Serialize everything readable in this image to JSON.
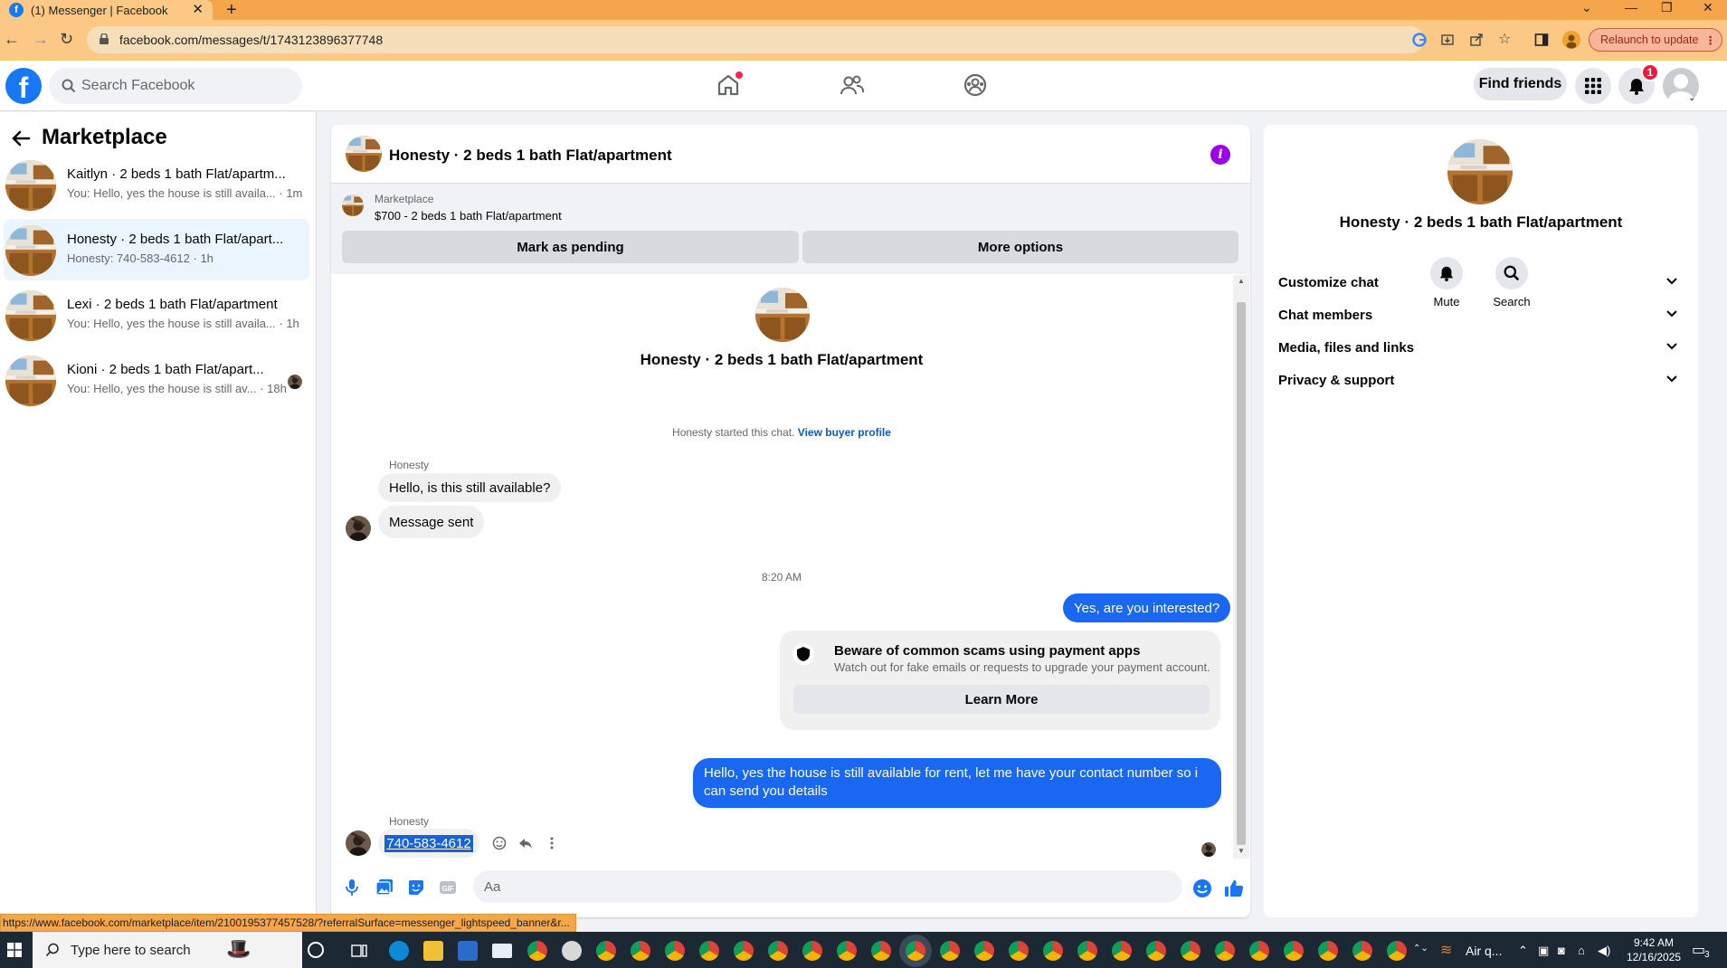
{
  "browser": {
    "tab_title": "(1) Messenger | Facebook",
    "url": "facebook.com/messages/t/1743123896377748",
    "relaunch_label": "Relaunch to update",
    "status_url": "https://www.facebook.com/marketplace/item/2100195377457528/?referralSurface=messenger_lightspeed_banner&r..."
  },
  "fb": {
    "search_placeholder": "Search Facebook",
    "find_friends": "Find friends",
    "notif_count": "1"
  },
  "sidebar": {
    "title": "Marketplace",
    "conversations": [
      {
        "name": "Kaitlyn · 2 beds 1 bath Flat/apartm...",
        "preview": "You: Hello, yes the house is still availa...",
        "time": "1m"
      },
      {
        "name": "Honesty · 2 beds 1 bath Flat/apart...",
        "preview": "Honesty: 740-583-4612",
        "time": "1h"
      },
      {
        "name": "Lexi · 2 beds 1 bath Flat/apartment",
        "preview": "You: Hello, yes the house is still availa...",
        "time": "1h"
      },
      {
        "name": "Kioni · 2 beds 1 bath Flat/apart...",
        "preview": "You: Hello, yes the house is still av...",
        "time": "18h"
      }
    ]
  },
  "chat": {
    "title": "Honesty · 2 beds 1 bath Flat/apartment",
    "listing_source": "Marketplace",
    "listing_price": "$700 - 2 beds 1 bath Flat/apartment",
    "mark_pending": "Mark as pending",
    "more_options": "More options",
    "started_text": "Honesty started this chat.",
    "view_profile": "View buyer profile",
    "sender_name": "Honesty",
    "msg1": "Hello, is this still available?",
    "msg2": "Message sent",
    "timestamp": "8:20 AM",
    "msg3": "Yes, are you interested?",
    "scam_title": "Beware of common scams using payment apps",
    "scam_text": "Watch out for fake emails or requests to upgrade your payment account.",
    "learn_more": "Learn More",
    "msg4": "Hello, yes the house is still available for rent, let me have your contact number so i can send you details",
    "sender_name2": "Honesty",
    "phone": "740-583-4612",
    "composer_placeholder": "Aa"
  },
  "right_panel": {
    "name": "Honesty · 2 beds 1 bath Flat/apartment",
    "mute": "Mute",
    "search": "Search",
    "items": [
      "Customize chat",
      "Chat members",
      "Media, files and links",
      "Privacy & support"
    ]
  },
  "taskbar": {
    "search_placeholder": "Type here to search",
    "weather": "Air q...",
    "time": "9:42 AM",
    "date": "12/16/2025",
    "notif_count": "3"
  },
  "colors": {
    "brand_blue": "#1877f2",
    "outgoing_bubble": "#1a67f2",
    "tab_orange": "#f5a54a",
    "info_purple": "#9b00e8"
  }
}
